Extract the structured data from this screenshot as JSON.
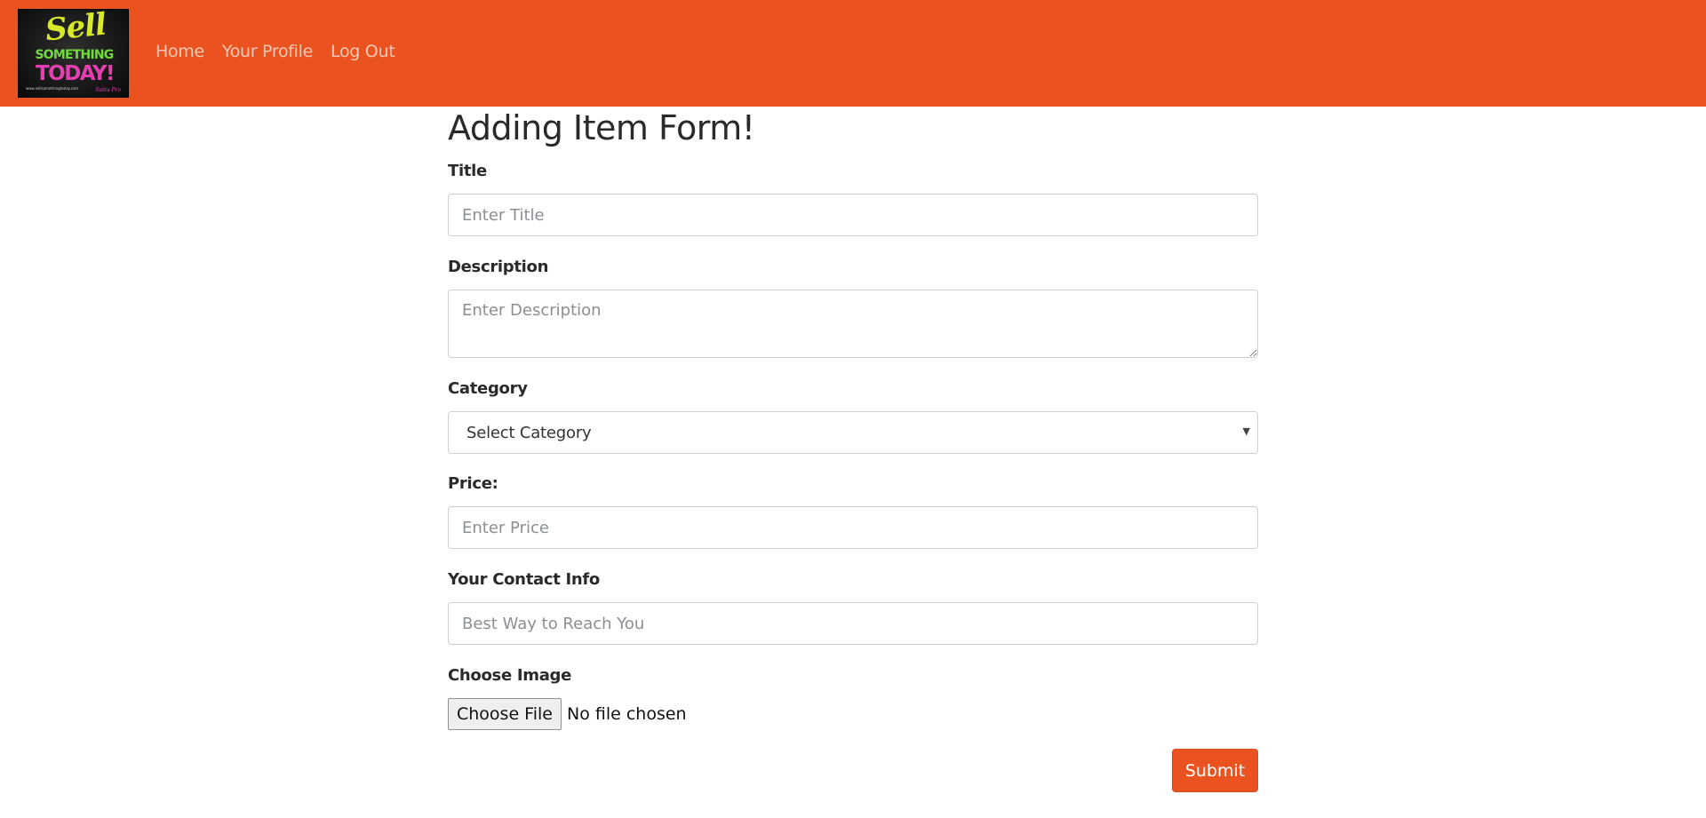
{
  "nav": {
    "logo": {
      "line1": "Sell",
      "line2": "SOMETHING",
      "line3": "TODAY!",
      "fine_print": "www.sellsomethingtoday.com",
      "signature": "Sales Pro"
    },
    "links": [
      "Home",
      "Your Profile",
      "Log Out"
    ]
  },
  "form": {
    "heading": "Adding Item Form!",
    "title_label": "Title",
    "title_placeholder": "Enter Title",
    "description_label": "Description",
    "description_placeholder": "Enter Description",
    "category_label": "Category",
    "category_selected": "Select Category",
    "price_label": "Price:",
    "price_placeholder": "Enter Price",
    "contact_label": "Your Contact Info",
    "contact_placeholder": "Best Way to Reach You",
    "image_label": "Choose Image",
    "file_button": "Choose File",
    "file_status": "No file chosen",
    "submit_label": "Submit"
  },
  "colors": {
    "brand": "#ea5320",
    "nav_link": "#f5c9b6",
    "border": "#cfcfcf"
  }
}
